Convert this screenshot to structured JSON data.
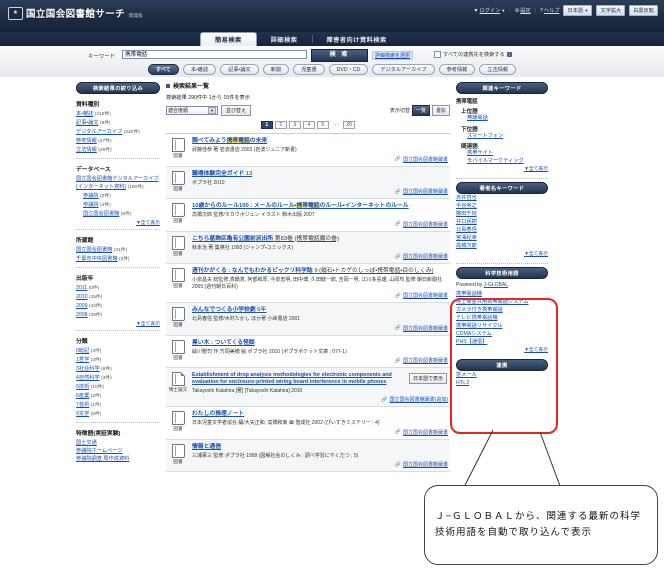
{
  "header": {
    "site_title": "国立国会図書館サーチ",
    "site_subtitle": "開発版",
    "login": "ログイン",
    "settings": "設定",
    "help": "ヘルプ",
    "language": "日本語",
    "text_enlarge": "文字拡大",
    "invert": "白黒反転",
    "icon_login": "user-icon",
    "icon_settings": "gear-icon",
    "icon_help": "question-icon"
  },
  "tabs": [
    {
      "label": "簡易検索",
      "active": true
    },
    {
      "label": "詳細検索",
      "active": false
    },
    {
      "label": "障害者向け資料検索",
      "active": false
    }
  ],
  "search": {
    "keyword_label": "キーワード",
    "keyword_value": "携帯電話",
    "keyword_placeholder": "キーワード",
    "search_button": "検 索",
    "advanced_link": "詳細検索を選択",
    "all_targets_label": "すべての連携先を検索する",
    "categories": [
      {
        "label": "すべて",
        "active": true
      },
      {
        "label": "本・雑誌",
        "active": false
      },
      {
        "label": "記事・論文",
        "active": false
      },
      {
        "label": "新聞",
        "active": false
      },
      {
        "label": "児童書",
        "active": false
      },
      {
        "label": "DVD・CD",
        "active": false
      },
      {
        "label": "デジタルアーカイブ",
        "active": false
      },
      {
        "label": "参考情報",
        "active": false
      },
      {
        "label": "立法情報",
        "active": false
      }
    ]
  },
  "facets": {
    "title": "検索結果の絞り込み",
    "show_all": "▼全て表示",
    "groups": [
      {
        "title": "資料種別",
        "items": [
          {
            "label": "本・雑誌",
            "count": "(219件)"
          },
          {
            "label": "記事・論文",
            "count": "(8件)"
          },
          {
            "label": "デジタルアーカイブ",
            "count": "(220件)"
          },
          {
            "label": "参考情報",
            "count": "(27件)"
          },
          {
            "label": "立法情報",
            "count": "(25件)"
          }
        ]
      },
      {
        "title": "データベース",
        "items": [
          {
            "label": "国立国会図書館デジタルアーカイブ(インターネット資料)",
            "count": "(180件)"
          },
          {
            "label": "参議院",
            "count": "(2件)",
            "indent": true
          },
          {
            "label": "参議院",
            "count": "(4件)",
            "indent": true
          },
          {
            "label": "国立国会図書館",
            "count": "(5件)",
            "indent": true
          }
        ],
        "show_all": "▼全て表示"
      },
      {
        "title": "所蔵館",
        "items": [
          {
            "label": "国立国会図書館",
            "count": "(31件)"
          },
          {
            "label": "千葉市中央図書館",
            "count": "(2件)"
          }
        ]
      },
      {
        "title": "出版年",
        "items": [
          {
            "label": "2011",
            "count": "(0件)"
          },
          {
            "label": "2010",
            "count": "(15件)"
          },
          {
            "label": "2009",
            "count": "(42件)"
          },
          {
            "label": "2008",
            "count": "(29件)"
          }
        ],
        "show_all": "▼全て表示"
      },
      {
        "title": "分類",
        "items": [
          {
            "label": "0総記",
            "count": "(3件)"
          },
          {
            "label": "1哲学",
            "count": "(2件)"
          },
          {
            "label": "3社会科学",
            "count": "(6件)"
          },
          {
            "label": "4自然科学",
            "count": "(3件)"
          },
          {
            "label": "5技術",
            "count": "(10件)"
          },
          {
            "label": "6産業",
            "count": "(2件)"
          },
          {
            "label": "7芸術",
            "count": "(1件)"
          },
          {
            "label": "9文学",
            "count": "(5件)"
          }
        ]
      },
      {
        "title": "特徴語(実証実験)",
        "items": [
          {
            "label": "国土交通",
            "count": ""
          },
          {
            "label": "参議院ホームページ",
            "count": ""
          },
          {
            "label": "参議院調査 局作成資料",
            "count": ""
          }
        ]
      }
    ]
  },
  "results": {
    "heading": "検索結果一覧",
    "count_text": "検索結果 290件中 1から 15件を表示",
    "sort_value": "適合度順",
    "sort_button": "並び替え",
    "display_label": "表示切替",
    "display_list": "一覧",
    "display_cover": "書影",
    "pages": [
      "1",
      "2",
      "3",
      "4",
      "5",
      "…",
      "20"
    ],
    "current_page": "1",
    "source_label": "国立国会図書館蔵書",
    "source_label_long": "国立国会図書館蔵書(追加)",
    "japanese_button": "日本語で表示",
    "items": [
      {
        "type": "図書",
        "icon": "book-icon",
        "title_pre": "調べてみよう",
        "title_hl": "携帯電話",
        "title_post": "の未来",
        "volume": "",
        "meta": "武藤佳恭 著  岩波書店 2003 (岩波ジュニア新書)",
        "source": "国立国会図書館蔵書"
      },
      {
        "type": "図書",
        "icon": "book-icon",
        "title_pre": "職場体験完全ガイド",
        "title_hl": "",
        "title_post": "",
        "volume": "13",
        "meta": "ポプラ社 2010",
        "source": "国立国会図書館蔵書"
      },
      {
        "type": "図書",
        "icon": "book-icon",
        "title_pre": "10歳からのルール100 : メールのルール・",
        "title_hl": "携帯電話",
        "title_post": "のルール・インターネットのルール",
        "volume": "",
        "meta": "高橋次郎 監修/タカウボジュン イラスト  鈴木出版 2007",
        "source": "国立国会図書館蔵書"
      },
      {
        "type": "図書",
        "icon": "book-icon",
        "title_pre": "こちら葛飾区亀有公園前派出所",
        "title_hl": "",
        "title_post": "",
        "volume": "第83巻 (携帯電話魔の巻)",
        "meta": "秋本治 著  集英社 1993 (ジャンプ・コミックス)",
        "source": "国立国会図書館蔵書"
      },
      {
        "type": "図書",
        "icon": "book-icon",
        "title_pre": "週刊かがくる : なんでもわかるビックリ科学誌",
        "title_hl": "",
        "title_post": "",
        "volume": "9 (磁石・トカゲのしっぽ・携帯電話・目のしくみ)",
        "meta": "小泉昌夫 総監修,真鍋真, 阿部和厚, 今泉忠明, 田中博, 久田健一郎, 吉岡一男, 江川多喜雄, 山岡均 監修  朝日新聞社 2005 (週刊朝日百科)",
        "source": "国立国会図書館蔵書"
      },
      {
        "type": "図書",
        "icon": "book-icon",
        "title_pre": "みんなでつくる小学校劇",
        "title_hl": "",
        "title_post": "",
        "volume": "6年",
        "meta": "北島春信 監修/木村たかし ほか著  小峰書店 2001",
        "source": "国立国会図書館蔵書"
      },
      {
        "type": "図書",
        "icon": "book-icon",
        "title_pre": "黒い木 : ついてくる怪談",
        "title_hl": "",
        "title_post": "",
        "volume": "",
        "meta": "緑川聖司 作,竹岡美穂 絵  ポプラ社 2010 (ポプラポケット文庫 ; 077-1)",
        "source": "国立国会図書館蔵書"
      },
      {
        "type": "博士論文",
        "icon": "document-icon",
        "title_pre": "Establishment of drop analysis methodologies for electronic components and evaluation for enclosure-printed wiring board interference in mobile phones",
        "title_hl": "",
        "title_post": "",
        "volume": "",
        "meta": "Takayoshi Katahira [著]  [Takayoshi Katahira] 2010",
        "source": "国立国会図書館蔵書(追加)",
        "button": "日本語で表示"
      },
      {
        "type": "図書",
        "icon": "book-icon",
        "title_pre": "わたしの推理ノート",
        "title_hl": "",
        "title_post": "",
        "volume": "",
        "meta": "日本児童文学者協会 編/大矢正和, 高橋和東 画  偕成社 2002 (ぴいすきミステリー ; 4)",
        "source": "国立国会図書館蔵書"
      },
      {
        "type": "図書",
        "icon": "book-icon",
        "title_pre": "情報と通信",
        "title_hl": "",
        "title_post": "",
        "volume": "",
        "meta": "三浦軍三 監修  ポプラ社 1999 (図解社会のしくみ : 調べ学習にやくだつ ; 5)",
        "source": "国立国会図書館蔵書"
      }
    ]
  },
  "right_sidebar": {
    "related_keywords": {
      "title": "関連キーワード",
      "term": "携帯電話",
      "broader_label": "上位語",
      "broader": [
        "無線電話"
      ],
      "narrower_label": "下位語",
      "narrower": [
        "スマートフォン"
      ],
      "related_label": "関連語",
      "related": [
        "携帯サイト",
        "モバイルマーケティング"
      ],
      "show_all": "▼全て表示"
    },
    "author_keywords": {
      "title": "著者名キーワード",
      "items": [
        "赤井哲也",
        "半谷英之",
        "藤田千枝",
        "井口民樹",
        "北島春信",
        "宮澤紀幸",
        "高橋次郎"
      ],
      "show_all": "▼全て表示"
    },
    "sci_terms": {
      "title": "科学技術用語",
      "powered_by": "Powered by",
      "powered_link": "J-GLOBAL",
      "items": [
        "携帯電話機",
        "地上衛星共用携帯電話システム",
        "カメラ付き携帯電話",
        "テレビ携帯電話機",
        "携帯電話リサイクル",
        "CDMAシステム",
        "PHS【通信】"
      ],
      "show_all": "▼全て表示",
      "highlight_color": "#e8261c"
    },
    "related_panel": {
      "title": "連携",
      "items": [
        "窓メール",
        "HTc.2"
      ]
    }
  },
  "callout": {
    "text": "Ｊ−ＧＬＯＢＡＬから、関連する最新の科学技術用語を自動で取り込んで表示"
  }
}
